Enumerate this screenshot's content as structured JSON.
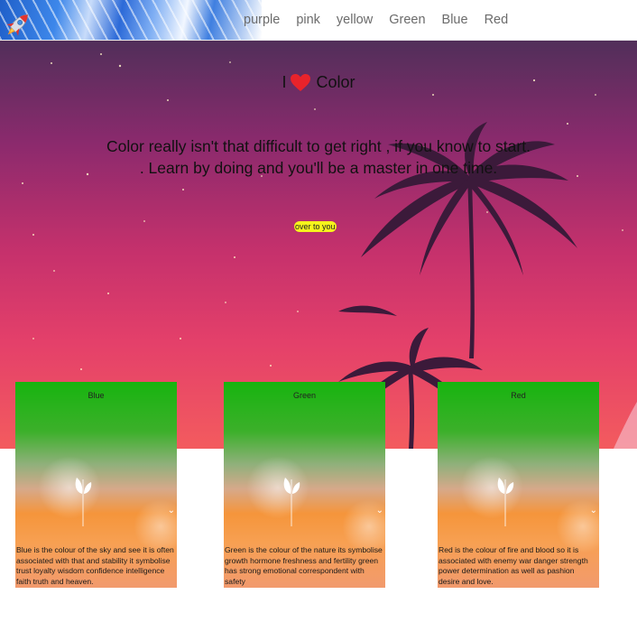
{
  "nav": {
    "logo_icon": "rocket-icon",
    "links": [
      "purple",
      "pink",
      "yellow",
      "Green",
      "Blue",
      "Red"
    ]
  },
  "hero": {
    "title_prefix": "I",
    "title_icon": "heart-icon",
    "title_suffix": "Color",
    "line1": "Color really isn't that difficult to get right , if you know to start.",
    "line2": ". Learn by doing and you'll be a master in one time.",
    "cta": "over to you",
    "colors": {
      "heart": "#e8232b",
      "cta_bg": "#f6f31c"
    }
  },
  "cards": [
    {
      "title": "Blue",
      "body": "Blue is the colour of the sky and see it is often associated with that and stability it symbolise trust loyalty wisdom confidence intelligence faith truth and heaven."
    },
    {
      "title": "Green",
      "body": "Green is the colour of the nature its symbolise growth hormone freshness and fertility green has strong emotional correspondent with safety"
    },
    {
      "title": "Red",
      "body": "Red is the colour of fire and blood so it is associated with enemy war danger strength power determination as well as pashion desire and love."
    }
  ]
}
